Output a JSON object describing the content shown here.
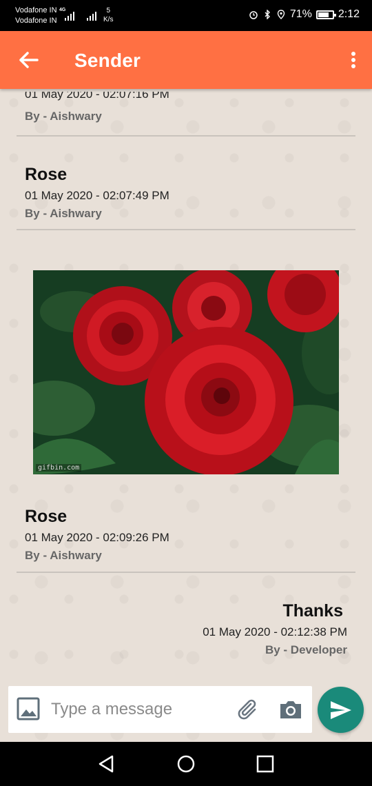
{
  "status_bar": {
    "carrier_1": "Vodafone IN",
    "carrier_2": "Vodafone IN",
    "network_tag": "4G",
    "speed_value": "5",
    "speed_unit": "K/s",
    "battery": "71%",
    "time": "2:12"
  },
  "app_bar": {
    "title": "Sender"
  },
  "messages": [
    {
      "title": "",
      "timestamp": "01 May 2020 - 02:07:16 PM",
      "author": "By - Aishwary"
    },
    {
      "title": "Rose",
      "timestamp": "01 May 2020 - 02:07:49 PM",
      "author": "By - Aishwary"
    },
    {
      "title": "Rose",
      "timestamp": "01 May 2020 - 02:09:26 PM",
      "author": "By - Aishwary",
      "image": "red-roses-gif"
    },
    {
      "title": "Thanks",
      "timestamp": "01 May 2020 - 02:12:38 PM",
      "author": "By - Developer"
    }
  ],
  "image_watermark": "gifbin.com",
  "composer": {
    "placeholder": "Type a message",
    "gallery_icon": "image-icon",
    "attach_icon": "paperclip-icon",
    "camera_icon": "camera-icon",
    "send_icon": "send-icon"
  },
  "colors": {
    "app_bar": "#ff7043",
    "send_button": "#1a8a7a",
    "author_text": "#666666"
  }
}
